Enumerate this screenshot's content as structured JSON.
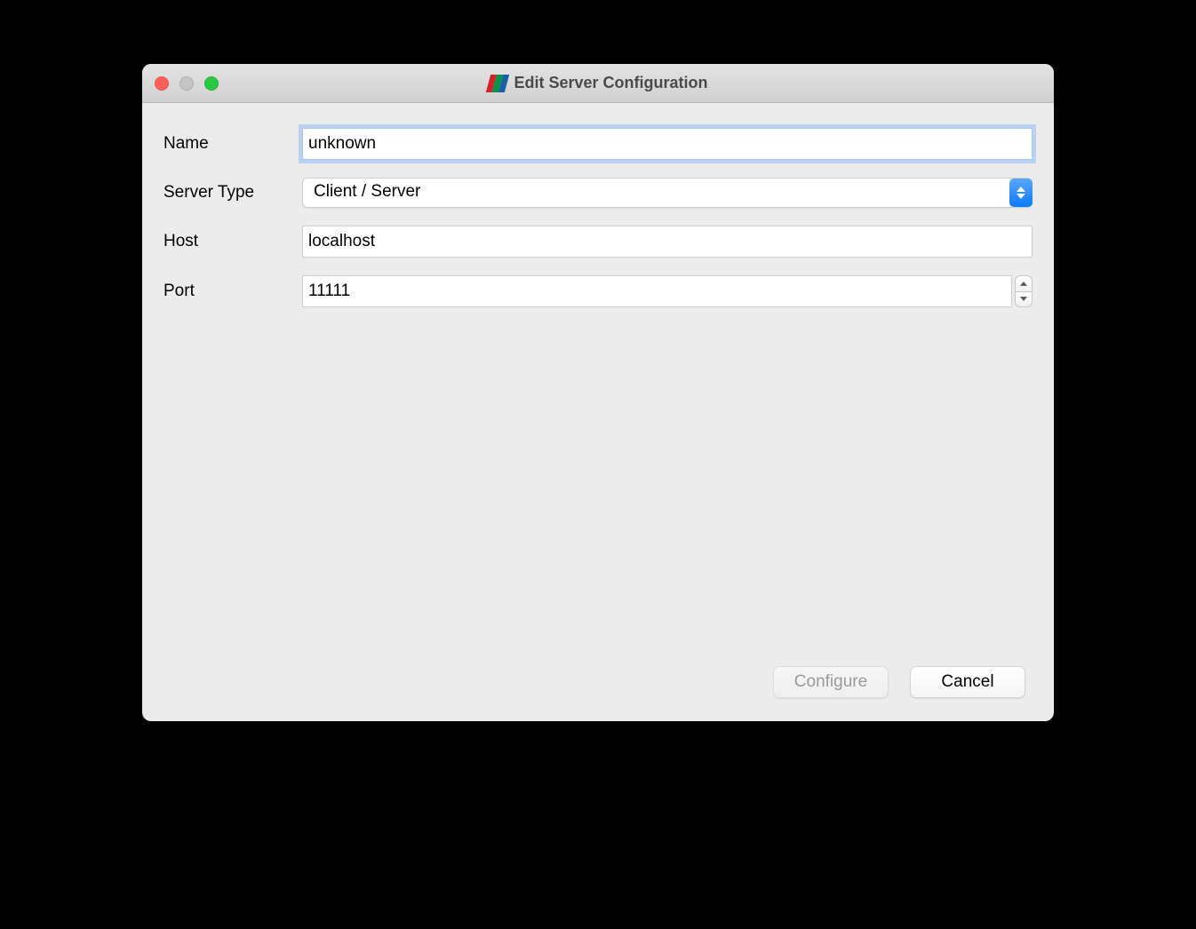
{
  "window": {
    "title": "Edit Server Configuration"
  },
  "form": {
    "name": {
      "label": "Name",
      "value": "unknown"
    },
    "serverType": {
      "label": "Server Type",
      "value": "Client / Server"
    },
    "host": {
      "label": "Host",
      "value": "localhost"
    },
    "port": {
      "label": "Port",
      "value": "11111"
    }
  },
  "buttons": {
    "configure": "Configure",
    "cancel": "Cancel"
  }
}
